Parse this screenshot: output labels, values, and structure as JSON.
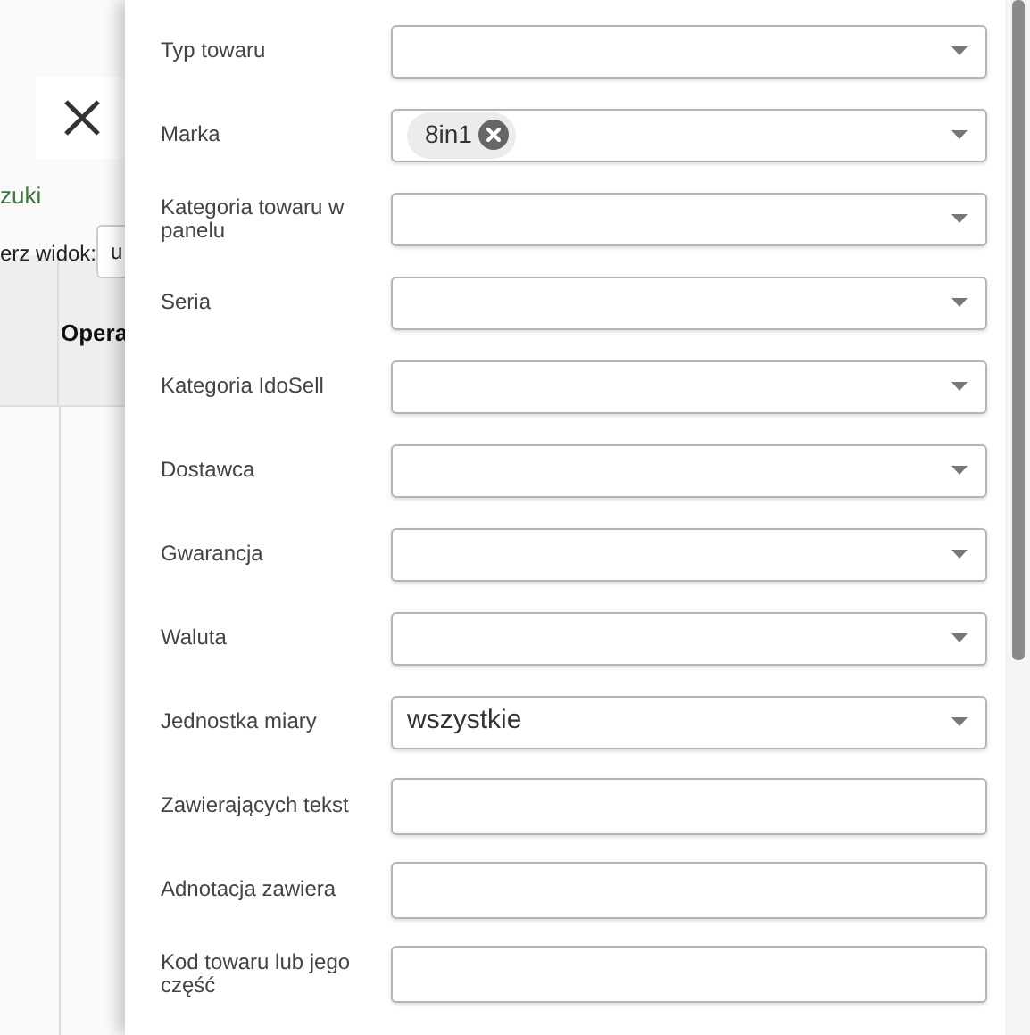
{
  "background": {
    "link": "zuki",
    "view_label": "erz widok:",
    "view_value": "u",
    "table_header": "Opera"
  },
  "filters": [
    {
      "label": "Typ towaru",
      "kind": "select"
    },
    {
      "label": "Marka",
      "kind": "select",
      "chips": [
        "8in1"
      ]
    },
    {
      "label": "Kategoria towaru w panelu",
      "kind": "select"
    },
    {
      "label": "Seria",
      "kind": "select"
    },
    {
      "label": "Kategoria IdoSell",
      "kind": "select"
    },
    {
      "label": "Dostawca",
      "kind": "select"
    },
    {
      "label": "Gwarancja",
      "kind": "select"
    },
    {
      "label": "Waluta",
      "kind": "select"
    },
    {
      "label": "Jednostka miary",
      "kind": "select",
      "value": "wszystkie"
    },
    {
      "label": "Zawierających tekst",
      "kind": "text"
    },
    {
      "label": "Adnotacja zawiera",
      "kind": "text"
    },
    {
      "label": "Kod towaru lub jego część",
      "kind": "text"
    }
  ]
}
